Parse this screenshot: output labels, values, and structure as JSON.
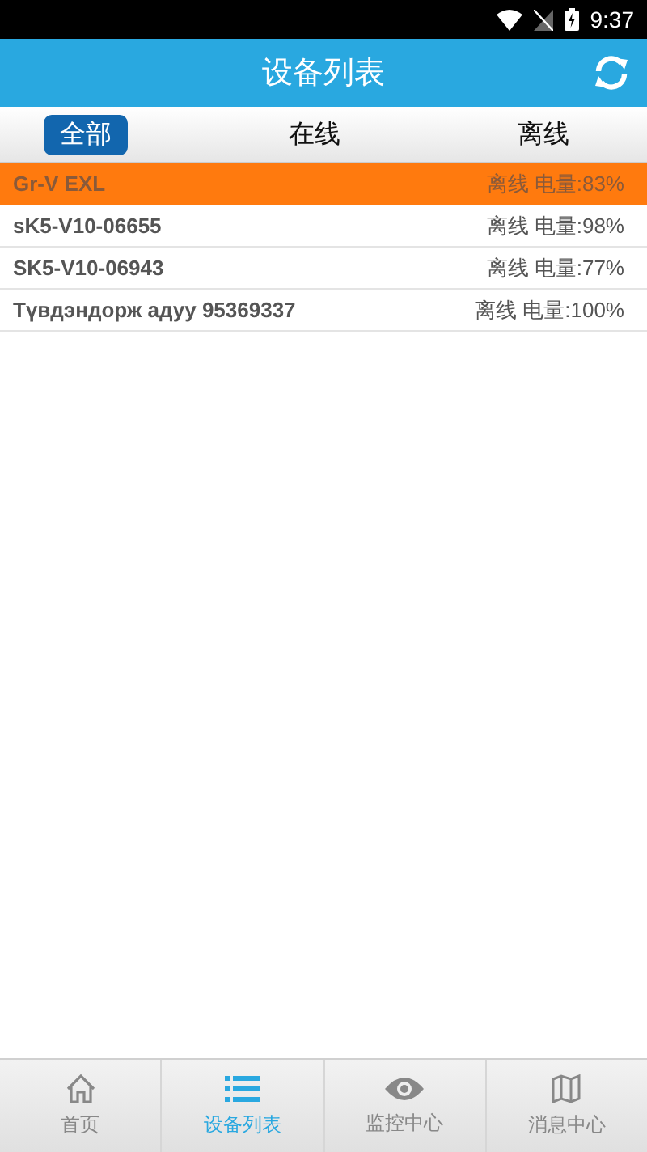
{
  "status_bar": {
    "time": "9:37"
  },
  "header": {
    "title": "设备列表"
  },
  "tabs": [
    {
      "label": "全部",
      "selected": true
    },
    {
      "label": "在线",
      "selected": false
    },
    {
      "label": "离线",
      "selected": false
    }
  ],
  "devices": [
    {
      "name": "Gr-V  EXL",
      "status": "离线 电量:83%",
      "selected": true
    },
    {
      "name": "sK5-V10-06655",
      "status": "离线 电量:98%",
      "selected": false
    },
    {
      "name": "SK5-V10-06943",
      "status": "离线 电量:77%",
      "selected": false
    },
    {
      "name": "Түвдэндорж адуу 95369337",
      "status": "离线 电量:100%",
      "selected": false
    }
  ],
  "bottom_nav": [
    {
      "label": "首页",
      "kind": "home",
      "selected": false
    },
    {
      "label": "设备列表",
      "kind": "list",
      "selected": true
    },
    {
      "label": "监控中心",
      "kind": "eye",
      "selected": false
    },
    {
      "label": "消息中心",
      "kind": "map",
      "selected": false
    }
  ]
}
